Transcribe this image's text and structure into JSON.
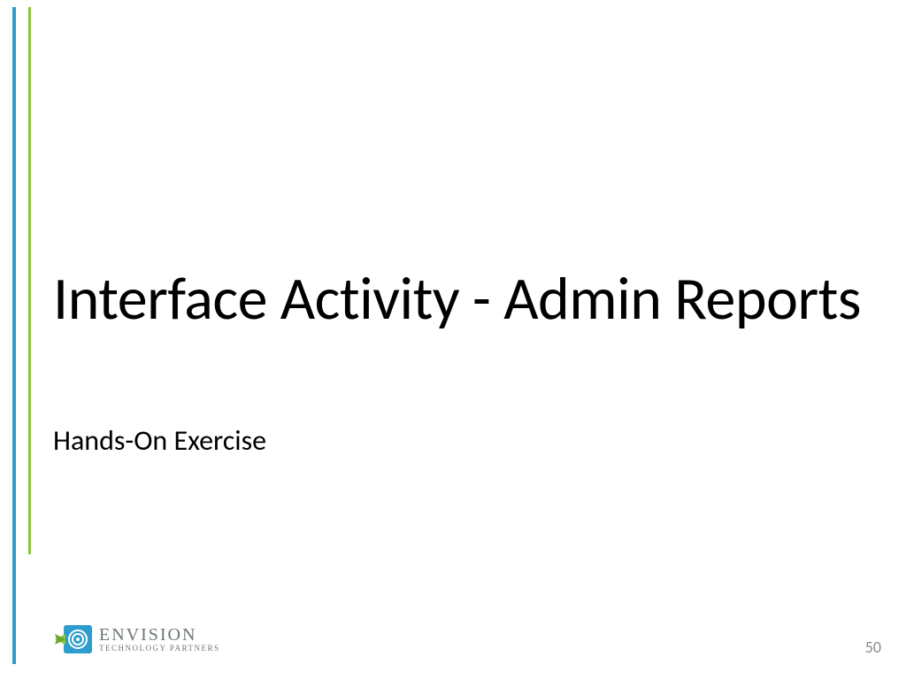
{
  "slide": {
    "title": "Interface Activity - Admin Reports",
    "subtitle": "Hands-On Exercise",
    "page_number": "50"
  },
  "logo": {
    "top": "ENVISION",
    "bottom": "TECHNOLOGY PARTNERS"
  },
  "colors": {
    "accent_blue": "#2e9ccc",
    "accent_green": "#8dc63f",
    "logo_gray": "#6d7679"
  }
}
